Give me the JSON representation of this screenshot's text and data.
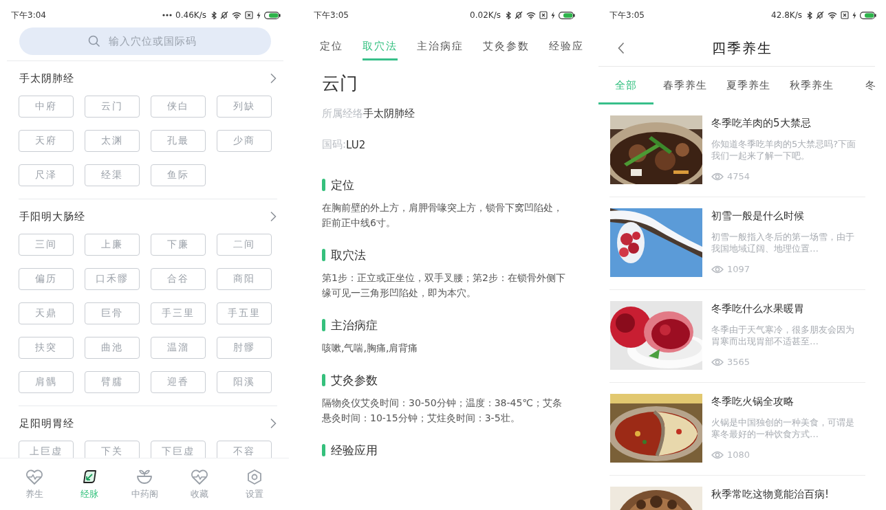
{
  "meridian_screen": {
    "status_bar": {
      "time": "下午3:04",
      "speed": "0.46K/s"
    },
    "search": {
      "placeholder": "输入穴位或国际码"
    },
    "meridians": [
      {
        "name": "手太阴肺经",
        "points": [
          "中府",
          "云门",
          "侠白",
          "列缺",
          "天府",
          "太渊",
          "孔最",
          "少商",
          "尺泽",
          "经渠",
          "鱼际"
        ]
      },
      {
        "name": "手阳明大肠经",
        "points": [
          "三间",
          "上廉",
          "下廉",
          "二间",
          "偏历",
          "口禾髎",
          "合谷",
          "商阳",
          "天鼎",
          "巨骨",
          "手三里",
          "手五里",
          "扶突",
          "曲池",
          "温溜",
          "肘髎",
          "肩髃",
          "臂臑",
          "迎香",
          "阳溪"
        ]
      },
      {
        "name": "足阳明胃经",
        "points": [
          "上巨虚",
          "下关",
          "下巨虚",
          "不容"
        ]
      }
    ],
    "nav": [
      {
        "label": "养生",
        "selected": false
      },
      {
        "label": "经脉",
        "selected": true
      },
      {
        "label": "中药阁",
        "selected": false
      },
      {
        "label": "收藏",
        "selected": false
      },
      {
        "label": "设置",
        "selected": false
      }
    ]
  },
  "acupoint_screen": {
    "status_bar": {
      "time": "下午3:05",
      "speed": "0.02K/s"
    },
    "tabs": [
      {
        "label": "定位",
        "selected": false
      },
      {
        "label": "取穴法",
        "selected": true
      },
      {
        "label": "主治病症",
        "selected": false
      },
      {
        "label": "艾灸参数",
        "selected": false
      },
      {
        "label": "经验应",
        "selected": false
      }
    ],
    "name": "云门",
    "meridian": {
      "label": "所属经络",
      "value": "手太阴肺经"
    },
    "code": {
      "label": "国码:",
      "value": "LU2"
    },
    "sections": [
      {
        "heading": "定位",
        "body": "在胸前壁的外上方，肩胛骨喙突上方，锁骨下窝凹陷处，距前正中线6寸。"
      },
      {
        "heading": "取穴法",
        "body": "第1步：正立或正坐位，双手叉腰；第2步：在锁骨外侧下缘可见一三角形凹陷处，即为本穴。"
      },
      {
        "heading": "主治病症",
        "body": "咳嗽,气喘,胸痛,肩背痛"
      },
      {
        "heading": "艾灸参数",
        "body": "隔物灸仪艾灸时间：30-50分钟；温度：38-45℃；艾条悬灸时间：10-15分钟；艾炷灸时间：3-5壮。"
      },
      {
        "heading": "经验应用"
      }
    ]
  },
  "seasonal_screen": {
    "status_bar": {
      "time": "下午3:05",
      "speed": "42.8K/s"
    },
    "title": "四季养生",
    "tabs": [
      {
        "label": "全部",
        "selected": true
      },
      {
        "label": "春季养生",
        "selected": false
      },
      {
        "label": "夏季养生",
        "selected": false
      },
      {
        "label": "秋季养生",
        "selected": false
      },
      {
        "label": "冬",
        "selected": false
      }
    ],
    "articles": [
      {
        "title": "冬季吃羊肉的5大禁忌",
        "summary": "你知道冬季吃羊肉的5大禁忌吗?下面我们一起来了解一下吧。",
        "views": "4754"
      },
      {
        "title": "初雪一般是什么时候",
        "summary": "初雪一般指入冬后的第一场雪，由于我国地域辽阔、地理位置…",
        "views": "1097"
      },
      {
        "title": "冬季吃什么水果暖胃",
        "summary": "冬季由于天气寒冷，很多朋友会因为胃寒而出现胃部不适甚至…",
        "views": "3565"
      },
      {
        "title": "冬季吃火锅全攻略",
        "summary": "火锅是中国独创的一种美食，可谓是寒冬最好的一种饮食方式…",
        "views": "1080"
      },
      {
        "title": "秋季常吃这物竟能治百病!"
      }
    ]
  }
}
